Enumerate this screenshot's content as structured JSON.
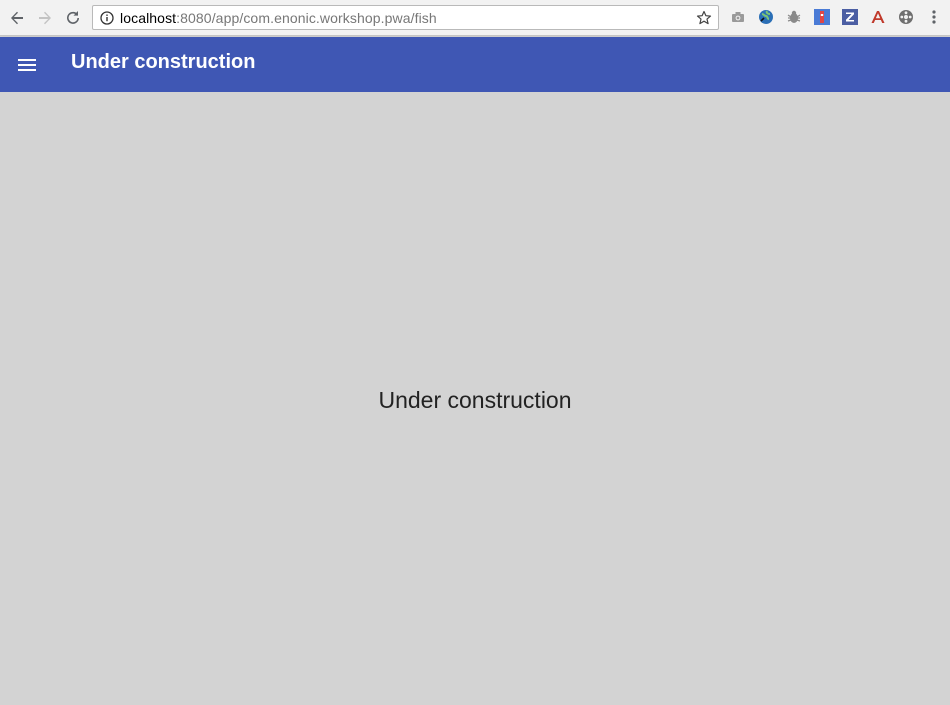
{
  "browser": {
    "url_host": "localhost",
    "url_rest": ":8080/app/com.enonic.workshop.pwa/fish",
    "icons": [
      "back-icon",
      "forward-icon",
      "reload-icon",
      "info-icon",
      "star-icon",
      "camera-icon",
      "globe-icon",
      "bug-icon",
      "extension-flag-icon",
      "zotero-icon",
      "acrobat-icon",
      "film-icon",
      "kebab-menu-icon"
    ]
  },
  "app_bar": {
    "title": "Under construction",
    "color": "#3f57b4"
  },
  "main": {
    "message": "Under construction",
    "background": "#d3d3d3"
  }
}
